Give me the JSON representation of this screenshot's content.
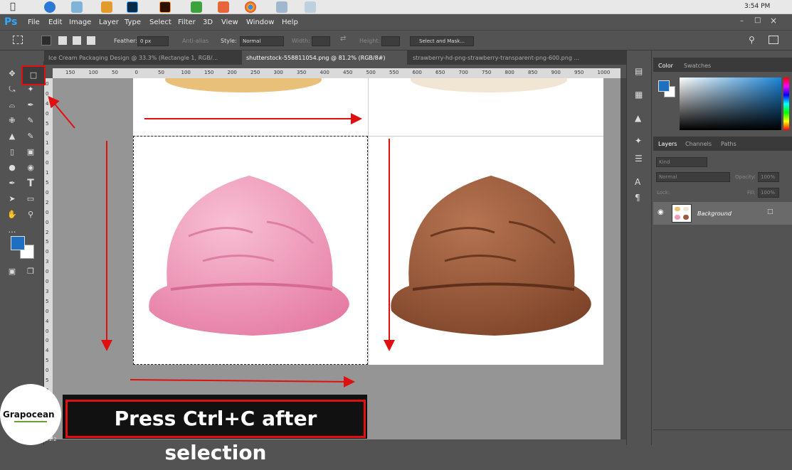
{
  "macbar": {
    "clock": "3:54 PM"
  },
  "app": {
    "logo": "Ps",
    "menu": [
      "File",
      "Edit",
      "Image",
      "Layer",
      "Type",
      "Select",
      "Filter",
      "3D",
      "View",
      "Window",
      "Help"
    ]
  },
  "options": {
    "feather_label": "Feather:",
    "feather_value": "0 px",
    "antialias_label": "Anti-alias",
    "style_label": "Style:",
    "style_value": "Normal",
    "width_label": "Width:",
    "height_label": "Height:",
    "select_mask_label": "Select and Mask..."
  },
  "tabs": [
    {
      "label": "Ice Cream Packaging Design @ 33.3% (Rectangle 1, RGB/...",
      "active": false
    },
    {
      "label": "shutterstock-558811054.png @ 81.2% (RGB/8#)",
      "active": true
    },
    {
      "label": "strawberry-hd-png-strawberry-transparent-png-600.png ...",
      "active": false
    }
  ],
  "ruler": {
    "h_ticks": [
      "150",
      "100",
      "50",
      "0",
      "50",
      "100",
      "150",
      "200",
      "250",
      "300",
      "350",
      "400",
      "450",
      "500",
      "550",
      "600",
      "650",
      "700",
      "750",
      "800",
      "850",
      "900",
      "950",
      "1000",
      "1050"
    ],
    "v_ticks": [
      "0",
      "0",
      "4",
      "0",
      "5",
      "0",
      "1",
      "0",
      "0",
      "1",
      "5",
      "0",
      "2",
      "0",
      "0",
      "2",
      "5",
      "0",
      "3",
      "0",
      "0",
      "3",
      "5",
      "0",
      "4",
      "0",
      "0",
      "4",
      "5",
      "0",
      "5",
      "0",
      "0",
      "5",
      "5",
      "0"
    ]
  },
  "zoom_readout": "81.2",
  "panels": {
    "color_tab": "Color",
    "swatches_tab": "Swatches",
    "layers_tab": "Layers",
    "channels_tab": "Channels",
    "paths_tab": "Paths",
    "kind_label": "Kind",
    "blend_mode": "Normal",
    "opacity_label": "Opacity:",
    "opacity_value": "100%",
    "lock_label": "Lock:",
    "fill_label": "Fill:",
    "fill_value": "100%",
    "layer_name": "Background"
  },
  "caption": "Press Ctrl+C after selection",
  "watermark": {
    "brand": "Grapocean"
  },
  "colors": {
    "accent_red": "#e01010",
    "foreground": "#1f6fc0",
    "pink_scoop": "#f19ab8",
    "brown_scoop": "#9b5a3b"
  }
}
